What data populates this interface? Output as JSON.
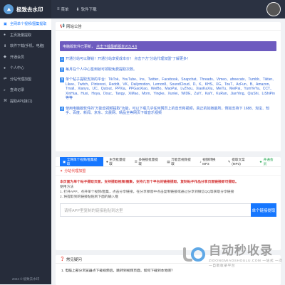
{
  "app": {
    "title": "极致去水印"
  },
  "topnav": {
    "items": [
      {
        "icon": "menu-icon",
        "label": "菜单"
      },
      {
        "icon": "download-icon",
        "label": "软件下载"
      }
    ]
  },
  "sidebar": {
    "items": [
      {
        "icon": "film-icon",
        "label": "全网单个视频/图集提取"
      },
      {
        "icon": "user-icon",
        "label": "主页批量提取"
      },
      {
        "icon": "download-icon",
        "label": "软件下载(手机、电脑)"
      },
      {
        "icon": "tag-icon",
        "label": "开通会员"
      },
      {
        "icon": "user-icon",
        "label": "个人中心"
      },
      {
        "icon": "share-icon",
        "label": "分站代理加盟"
      },
      {
        "icon": "search-icon",
        "label": "查询记录"
      },
      {
        "icon": "code-icon",
        "label": "提取API(接口)"
      }
    ],
    "footer": "2024 © 极致去水印"
  },
  "announcement": {
    "header": "网站公告",
    "notice_text": "电脑版软件已更新，",
    "notice_link": "点击下载最新版本V15.4.6",
    "tips": [
      {
        "num": "1",
        "text": "开通分站可以赚钱！开通分站享受成本价！ 点击下方\"分站代理加盟\"了解更多！"
      },
      {
        "num": "2",
        "text": "每月在个人中心签到就可领取免费提取次数。"
      },
      {
        "num": "3",
        "text": "单个帖子提取支持的平台：TikTok、YouTube、Ins、Twitter、Facebook、Snapchat、Threads、Vimeo、afreecatv、Tumblr、Tiktier、Likee、Twitch、Pinterest、Reddit、VK、Dailymotion、Lemon8、SoundCloud、D、K、KHS、XG、TouT、AcFun、B、Amazon、Tmall、Xianyu、UC、Qutout、PPXia、PPGaoXiao、WeiBo、MaoPai、LvZhou、XiaoKaXiu、MeiTu、MeiPai、YumYeYa、CCT、XinHua、Huxi、Hoya、Douc、Tangy、XiMao、Mom、Yingke、Xunlei、WIDE、ZuiY、KaiY、KuRan、JianYing、QiuShi、LiShiPin等等"
      },
      {
        "num": "4",
        "text": "使用电脑版软件的\"万能音视频提取\"功能，可以下载几乎任何网页上的音乐和视频，真正的如她最所。例如支持下 1688、淘宝、知乎、百度、新闻、京东、文晨网、晴品全等网页下载音乐视频"
      }
    ]
  },
  "tool": {
    "tabs": [
      {
        "icon": "film-icon",
        "label": "全网单个视频/图集提取",
        "active": true
      },
      {
        "icon": "user-icon",
        "label": "主页批量提取"
      },
      {
        "icon": "list-icon",
        "label": "多链接批量提取"
      },
      {
        "icon": "file-icon",
        "label": "万能音视频提取"
      },
      {
        "icon": "music-icon",
        "label": "视频转换MP3"
      },
      {
        "icon": "text-icon",
        "label": "提取文案(MP3)"
      },
      {
        "icon": "star-icon",
        "label": "开通会员"
      }
    ],
    "subtag": "分站代理加盟",
    "desc_strong": "本页面为单个帖子提取页面，支持提取视频/图集，支持几百个平台的链接提取，复制帖子作品分享页面链接即可提取。",
    "usage_title": "使用方法",
    "usage_steps": [
      "1. 打开APP，点开单个视频/图集，点击分享链接，在分享弹窗中点击复制链接或通过分享到微信QQ等获取分享链接",
      "2. 将提取到的链接粘贴到下面的输入框"
    ],
    "input_placeholder": "请将APP里复制的链接粘贴到这里",
    "extract_button": "单个链接提取"
  },
  "faq": {
    "header": "常见疑问",
    "items": [
      "1. 电脑上部分浏览器点下载视频后，跳转到视频页面，如何下载到本地呢？"
    ]
  },
  "watermark": {
    "title": "自动秒收录",
    "subtitle": "ZIDONGMIAOSHOULU.COM 一站式 一次 一自助收录平台"
  },
  "colors": {
    "sidebar_bg": "#262c3a",
    "accent": "#1677ff",
    "notice_bg": "#6d5bbf",
    "red": "#e53935"
  }
}
